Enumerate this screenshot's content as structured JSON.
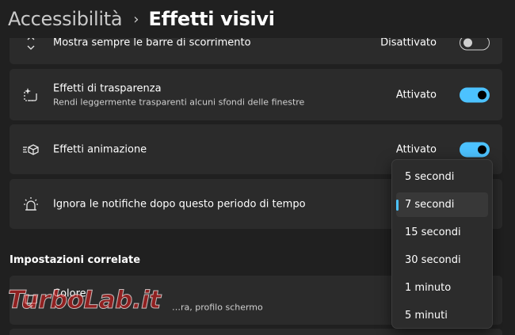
{
  "breadcrumb": {
    "parent": "Accessibilità",
    "separator": "›",
    "current": "Effetti visivi"
  },
  "settings": [
    {
      "icon": "scrollbar-icon",
      "title": "Mostra sempre le barre di scorrimento",
      "state": "Disattivato",
      "toggle_on": false
    },
    {
      "icon": "transparency-icon",
      "title": "Effetti di trasparenza",
      "subtitle": "Rendi leggermente trasparenti alcuni sfondi delle finestre",
      "state": "Attivato",
      "toggle_on": true
    },
    {
      "icon": "animation-icon",
      "title": "Effetti animazione",
      "state": "Attivato",
      "toggle_on": true
    },
    {
      "icon": "notification-light-icon",
      "title": "Ignora le notifiche dopo questo periodo di tempo"
    }
  ],
  "related": {
    "title": "Impostazioni correlate",
    "item": {
      "title": "Colore",
      "subtitle": "…ra, profilo schermo"
    }
  },
  "dropdown": {
    "options": [
      "5 secondi",
      "7 secondi",
      "15 secondi",
      "30 secondi",
      "1 minuto",
      "5 minuti"
    ],
    "selected": "7 secondi"
  },
  "watermark": {
    "text": "TurboLab.it"
  },
  "colors": {
    "accent": "#4cc2ff",
    "background": "#202020",
    "card": "#2b2b2b"
  }
}
